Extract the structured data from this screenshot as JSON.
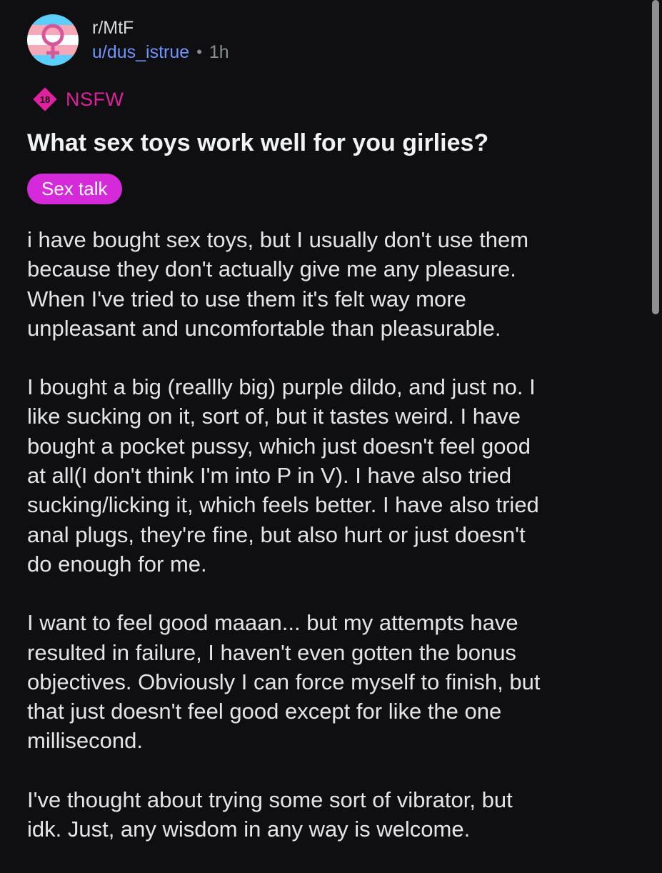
{
  "post": {
    "subreddit": "r/MtF",
    "username": "u/dus_istrue",
    "separator": "•",
    "time": "1h",
    "nsfw_badge": "18",
    "nsfw_label": "NSFW",
    "title": "What sex toys work well for you girlies?",
    "flair": "Sex talk",
    "paragraphs": [
      "i have bought sex toys, but I usually don't use them\nbecause they don't actually give me any pleasure.\nWhen I've tried to use them it's felt way more\nunpleasant and uncomfortable than pleasurable.",
      "I bought a big (reallly big) purple dildo, and just no. I\nlike sucking on it, sort of, but it tastes weird. I have\nbought a pocket pussy, which just doesn't feel good\nat all(I don't think I'm into P in V). I have also tried\nsucking/licking it, which feels better. I have also tried\nanal plugs, they're fine, but also hurt or just doesn't\ndo enough for me.",
      "I want to feel good maaan... but my attempts have\nresulted in failure, I haven't even gotten the bonus\nobjectives. Obviously I can force myself to finish, but\nthat just doesn't feel good except for like the one\nmillisecond.",
      "I've thought about trying some sort of vibrator, but\nidk. Just, any wisdom in any way is welcome."
    ]
  },
  "icons": {
    "avatar": "trans-flag-symbol-icon",
    "nsfw": "nsfw-18-icon"
  },
  "colors": {
    "background": "#0f0f11",
    "username": "#7193ff",
    "nsfw": "#e0219d",
    "flair_bg": "#d42ad9",
    "trans_blue": "#5bcefa",
    "trans_pink": "#f5a9b8",
    "trans_white": "#ffffff"
  }
}
